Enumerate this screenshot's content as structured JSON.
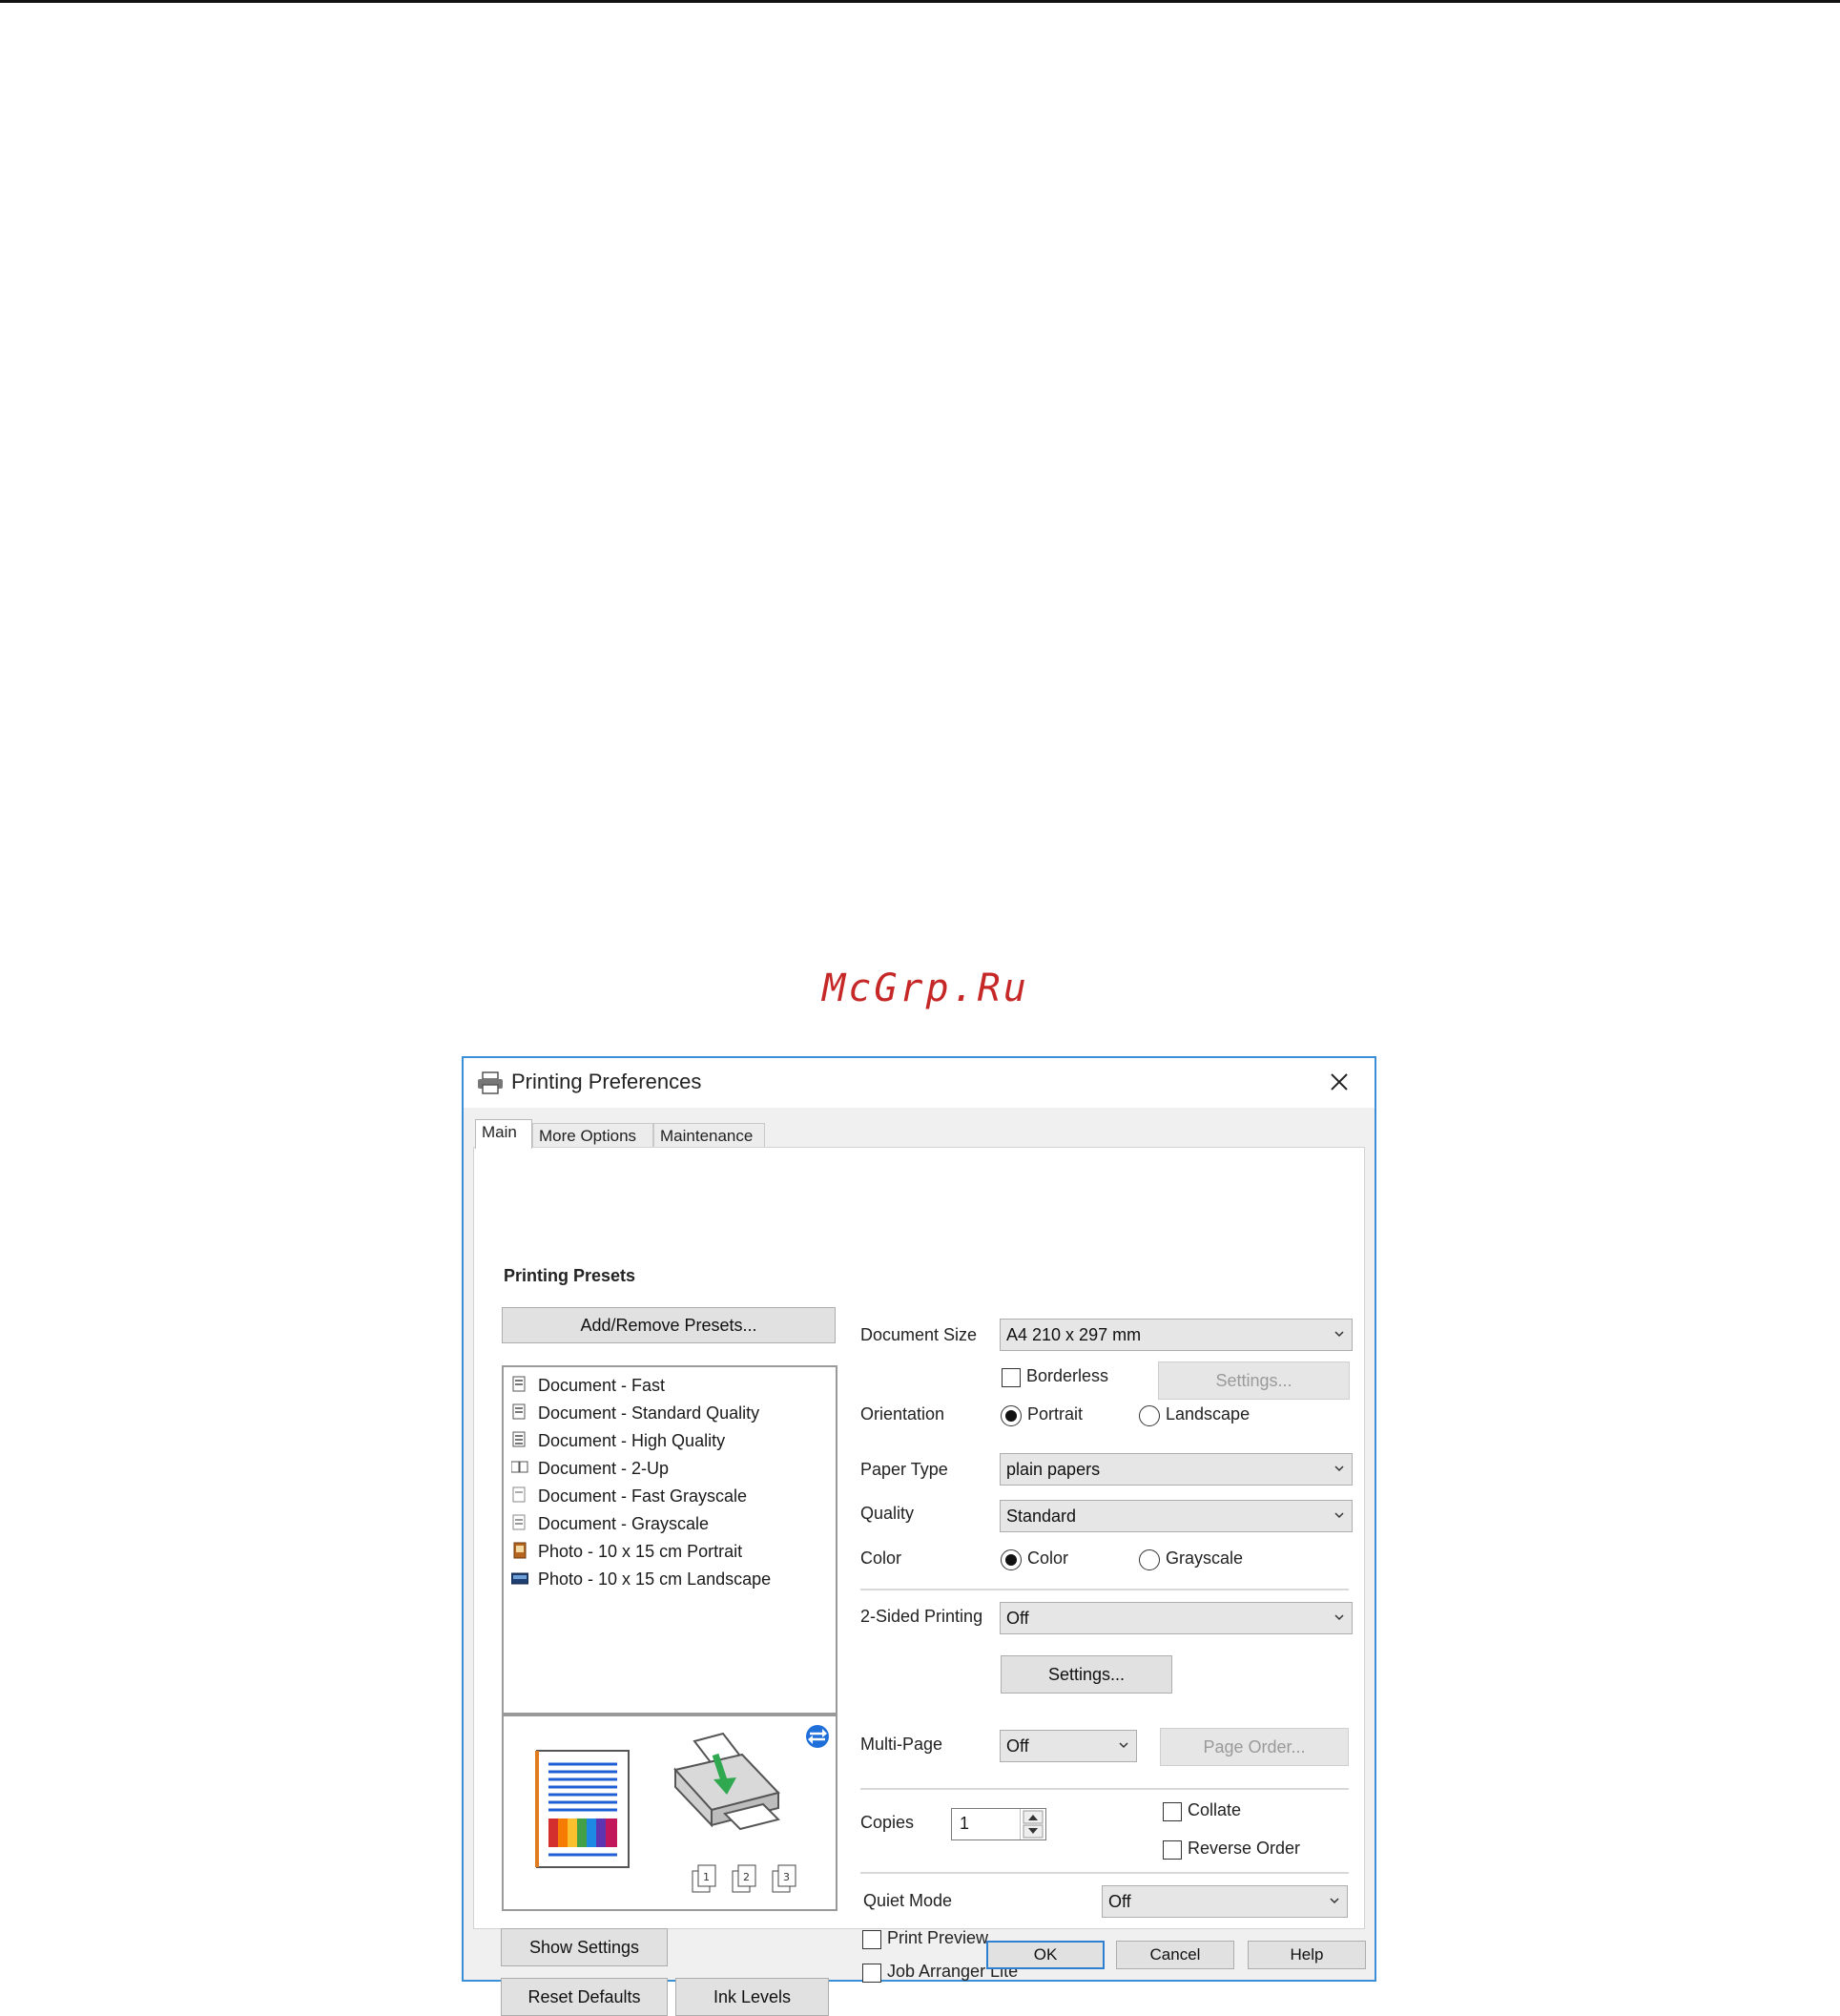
{
  "watermark": "McGrp.Ru",
  "dialog": {
    "title": "Printing Preferences",
    "tabs": [
      "Main",
      "More Options",
      "Maintenance"
    ],
    "presets_heading": "Printing Presets",
    "add_remove_label": "Add/Remove Presets...",
    "presets": [
      "Document - Fast",
      "Document - Standard Quality",
      "Document - High Quality",
      "Document - 2-Up",
      "Document - Fast Grayscale",
      "Document - Grayscale",
      "Photo - 10 x 15 cm Portrait",
      "Photo - 10 x 15 cm Landscape"
    ],
    "show_settings_label": "Show Settings",
    "reset_defaults_label": "Reset Defaults",
    "ink_levels_label": "Ink Levels",
    "document_size": {
      "label": "Document Size",
      "value": "A4 210 x 297 mm"
    },
    "borderless": {
      "label": "Borderless",
      "checked": false
    },
    "borderless_settings_label": "Settings...",
    "orientation": {
      "label": "Orientation",
      "portrait": "Portrait",
      "landscape": "Landscape",
      "selected": "Portrait"
    },
    "paper_type": {
      "label": "Paper Type",
      "value": "plain papers"
    },
    "quality": {
      "label": "Quality",
      "value": "Standard"
    },
    "color": {
      "label": "Color",
      "color": "Color",
      "grayscale": "Grayscale",
      "selected": "Color"
    },
    "two_sided": {
      "label": "2-Sided Printing",
      "value": "Off"
    },
    "two_sided_settings_label": "Settings...",
    "multi_page": {
      "label": "Multi-Page",
      "value": "Off"
    },
    "page_order_label": "Page Order...",
    "copies": {
      "label": "Copies",
      "value": "1"
    },
    "collate": {
      "label": "Collate",
      "checked": false
    },
    "reverse_order": {
      "label": "Reverse Order",
      "checked": false
    },
    "quiet_mode": {
      "label": "Quiet Mode",
      "value": "Off"
    },
    "print_preview": {
      "label": "Print Preview",
      "checked": false
    },
    "job_arranger": {
      "label": "Job Arranger Lite",
      "checked": false
    },
    "ok_label": "OK",
    "cancel_label": "Cancel",
    "help_label": "Help",
    "preview_page_numbers": [
      "1",
      "2",
      "3"
    ]
  },
  "colors": {
    "accent": "#3b8fd6",
    "watermark": "#c62828",
    "green_arrow": "#2fa84f"
  }
}
